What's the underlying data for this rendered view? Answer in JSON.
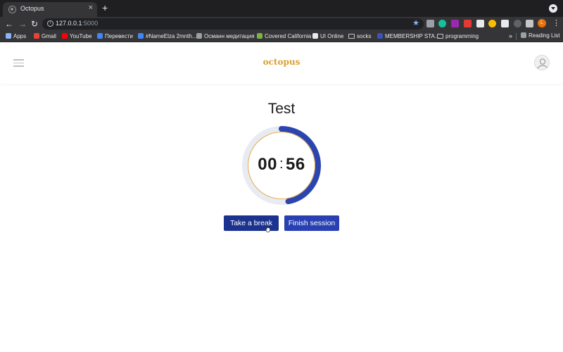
{
  "browser": {
    "tab": {
      "title": "Octopus",
      "close_glyph": "×"
    },
    "new_tab_glyph": "+",
    "nav": {
      "back": "←",
      "forward": "→",
      "reload": "↻"
    },
    "address": {
      "host": "127.0.0.1",
      "port": ":5000",
      "info_glyph": "i",
      "star_glyph": "★"
    },
    "profile_initial": "L",
    "menu_glyph": "⋮",
    "bookmarks": [
      {
        "label": "Apps",
        "icon": "apps-icon",
        "color": "#8ab4f8"
      },
      {
        "label": "Gmail",
        "icon": "gmail-icon",
        "color": "#ea4335"
      },
      {
        "label": "YouTube",
        "icon": "youtube-icon",
        "color": "#ff0000"
      },
      {
        "label": "Перевести",
        "icon": "translate-icon",
        "color": "#4285f4"
      },
      {
        "label": "#NameElza 2mnth...",
        "icon": "docs-icon",
        "color": "#4285f4"
      },
      {
        "label": "Османн медитация",
        "icon": "site-icon",
        "color": "#9aa0a6"
      },
      {
        "label": "Covered California",
        "icon": "site-icon",
        "color": "#7cb342"
      },
      {
        "label": "UI Online",
        "icon": "site-icon",
        "color": "#e8eaed"
      },
      {
        "label": "socks",
        "icon": "folder-icon",
        "color": ""
      },
      {
        "label": "MEMBERSHIP STA...",
        "icon": "site-icon",
        "color": "#3f51b5"
      },
      {
        "label": "programming",
        "icon": "folder-icon",
        "color": ""
      }
    ],
    "bookmarks_more": "»",
    "reading_list": "Reading List"
  },
  "app": {
    "brand": "octopus",
    "session_title": "Test",
    "timer": {
      "minutes": "00",
      "separator": ":",
      "seconds": "56",
      "progress": 0.47
    },
    "buttons": {
      "break_label": "Take a break",
      "finish_label": "Finish session"
    }
  },
  "colors": {
    "accent_gold": "#d9a030",
    "ring_blue": "#2b45b0",
    "ring_track": "#e8ebf2",
    "button_primary": "#1b328f",
    "button_secondary": "#2940b3"
  }
}
